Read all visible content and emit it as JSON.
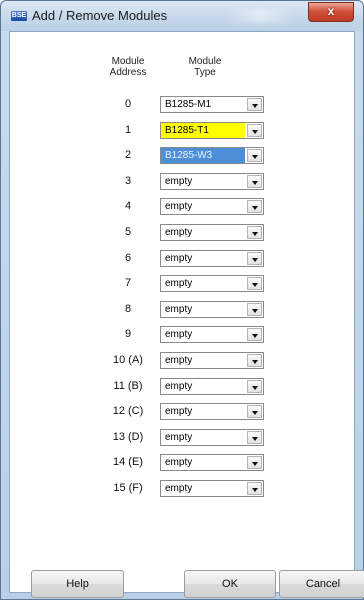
{
  "window": {
    "title": "Add / Remove Modules",
    "icon_text": "BSE",
    "close_symbol": "x"
  },
  "table": {
    "header_address": "Module\nAddress",
    "header_type": "Module\nType",
    "rows": [
      {
        "address": "0",
        "type": "B1285-M1"
      },
      {
        "address": "1",
        "type": "B1285-T1",
        "highlight": "#ffff00"
      },
      {
        "address": "2",
        "type": "B1285-W3",
        "highlight": "#4c8fd6"
      },
      {
        "address": "3",
        "type": "empty"
      },
      {
        "address": "4",
        "type": "empty"
      },
      {
        "address": "5",
        "type": "empty"
      },
      {
        "address": "6",
        "type": "empty"
      },
      {
        "address": "7",
        "type": "empty"
      },
      {
        "address": "8",
        "type": "empty"
      },
      {
        "address": "9",
        "type": "empty"
      },
      {
        "address": "10 (A)",
        "type": "empty"
      },
      {
        "address": "11 (B)",
        "type": "empty"
      },
      {
        "address": "12 (C)",
        "type": "empty"
      },
      {
        "address": "13 (D)",
        "type": "empty"
      },
      {
        "address": "14 (E)",
        "type": "empty"
      },
      {
        "address": "15 (F)",
        "type": "empty"
      }
    ]
  },
  "buttons": {
    "help": "Help",
    "ok": "OK",
    "cancel": "Cancel"
  }
}
